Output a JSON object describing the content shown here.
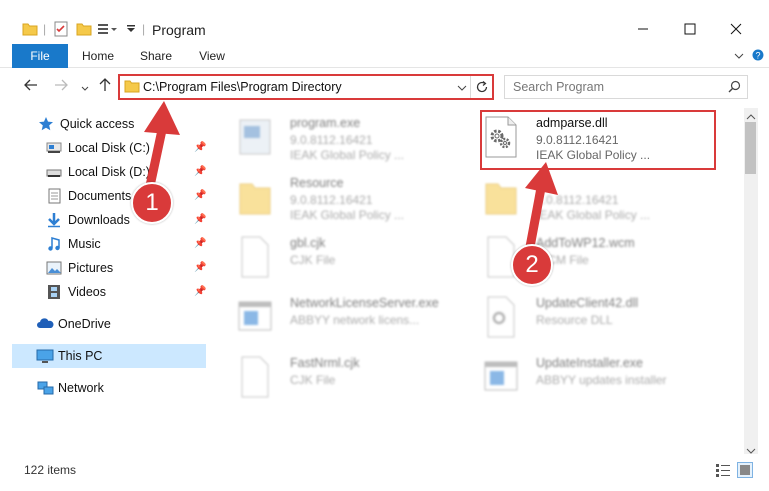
{
  "window": {
    "title": "Program",
    "minimize_icon": "minimize-icon",
    "maximize_icon": "maximize-icon",
    "close_icon": "close-icon"
  },
  "ribbon": {
    "tabs": [
      {
        "label": "File"
      },
      {
        "label": "Home"
      },
      {
        "label": "Share"
      },
      {
        "label": "View"
      }
    ]
  },
  "address": {
    "path": "C:\\Program Files\\Program Directory"
  },
  "search": {
    "placeholder": "Search Program"
  },
  "nav": {
    "quick_access": "Quick access",
    "items": [
      {
        "label": "Local Disk (C:)"
      },
      {
        "label": "Local Disk (D:)"
      },
      {
        "label": "Documents"
      },
      {
        "label": "Downloads"
      },
      {
        "label": "Music"
      },
      {
        "label": "Pictures"
      },
      {
        "label": "Videos"
      }
    ],
    "onedrive": "OneDrive",
    "this_pc": "This PC",
    "network": "Network"
  },
  "files": [
    {
      "name": "program.exe",
      "line1": "9.0.8112.16421",
      "line2": "IEAK Global Policy ..."
    },
    {
      "name": "admparse.dll",
      "line1": "9.0.8112.16421",
      "line2": "IEAK Global Policy ..."
    },
    {
      "name": "Resource",
      "line1": "9.0.8112.16421",
      "line2": "IEAK Global Policy ..."
    },
    {
      "name": "",
      "line1": "9.0.8112.16421",
      "line2": "IEAK Global Policy ..."
    },
    {
      "name": "gbl.cjk",
      "line1": "CJK File",
      "line2": ""
    },
    {
      "name": "AddToWP12.wcm",
      "line1": "WCM File",
      "line2": ""
    },
    {
      "name": "NetworkLicenseServer.exe",
      "line1": "ABBYY network licens...",
      "line2": ""
    },
    {
      "name": "UpdateClient42.dll",
      "line1": "Resource DLL",
      "line2": ""
    },
    {
      "name": "FastNrml.cjk",
      "line1": "CJK File",
      "line2": ""
    },
    {
      "name": "UpdateInstaller.exe",
      "line1": "ABBYY updates installer",
      "line2": ""
    }
  ],
  "status": {
    "item_count": "122 items"
  },
  "callouts": {
    "one": "1",
    "two": "2"
  },
  "colors": {
    "accent": "#1979ca",
    "highlight": "#d93a3a",
    "selection": "#cce8ff"
  }
}
